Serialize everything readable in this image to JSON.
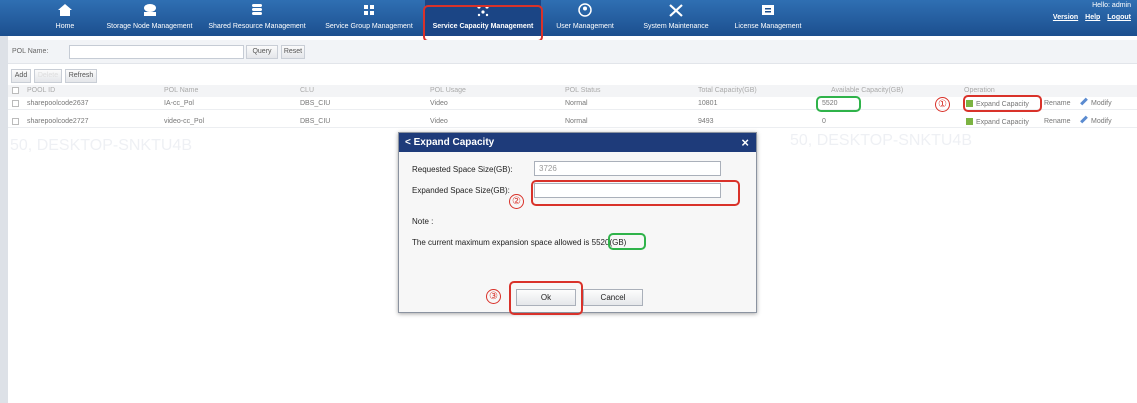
{
  "nav": {
    "items": [
      {
        "label": "Home",
        "icon": "home-icon"
      },
      {
        "label": "Storage Node Management",
        "icon": "storage-node-icon"
      },
      {
        "label": "Shared Resource Management",
        "icon": "database-icon"
      },
      {
        "label": "Service Group Management",
        "icon": "grid-icon"
      },
      {
        "label": "Service Capacity Management",
        "icon": "capacity-icon"
      },
      {
        "label": "User Management",
        "icon": "user-icon"
      },
      {
        "label": "System Maintenance",
        "icon": "tools-icon"
      },
      {
        "label": "License Management",
        "icon": "license-icon"
      }
    ],
    "greeting": "Hello: admin",
    "version": "Version",
    "help": "Help",
    "logout": "Logout"
  },
  "search": {
    "label": "POL Name:",
    "query": "Query",
    "reset": "Reset"
  },
  "toolbar": {
    "add": "Add",
    "delete": "Delete",
    "refresh": "Refresh"
  },
  "table": {
    "headers": [
      "POOL ID",
      "POL Name",
      "CLU",
      "POL Usage",
      "POL Status",
      "Total Capacity(GB)",
      "Available Capacity(GB)",
      "Operation"
    ],
    "rows": [
      {
        "pool_id": "sharepoolcode2637",
        "name": "IA-cc_Pol",
        "clu": "DBS_CIU",
        "usage": "Video",
        "status": "Normal",
        "total": "10801",
        "available": "5520"
      },
      {
        "pool_id": "sharepoolcode2727",
        "name": "video-cc_Pol",
        "clu": "DBS_CIU",
        "usage": "Video",
        "status": "Normal",
        "total": "9493",
        "available": "0"
      }
    ],
    "ops": {
      "expand": "Expand Capacity",
      "rename": "Rename",
      "modify": "Modify"
    }
  },
  "annotations": {
    "one": "①",
    "two": "②",
    "three": "③"
  },
  "modal": {
    "title": "Expand Capacity",
    "close": "×",
    "requested_label": "Requested Space Size(GB):",
    "requested_value": "3726",
    "expanded_label": "Expanded Space Size(GB):",
    "expanded_value": "",
    "note_label": "Note :",
    "note_text": "The current maximum expansion space allowed is",
    "note_value": "5520(GB)",
    "ok": "Ok",
    "cancel": "Cancel"
  },
  "watermark": "50, DESKTOP-SNKTU4B",
  "colors": {
    "nav_bg": "#2f6fb3",
    "modal_head": "#1e3b7a",
    "highlight_red": "#d9322a",
    "highlight_green": "#2fb34a"
  }
}
